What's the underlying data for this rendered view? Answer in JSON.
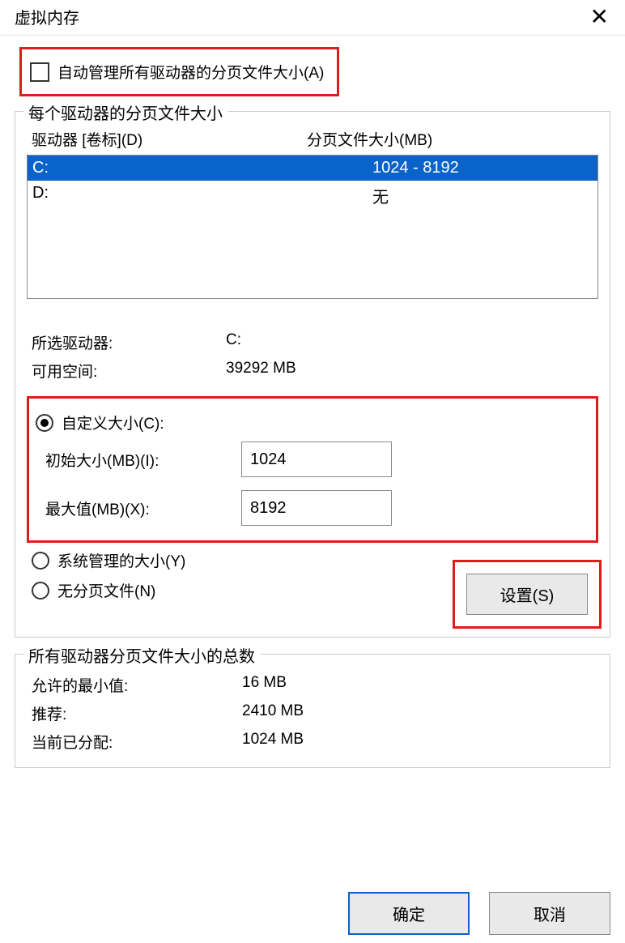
{
  "title": "虚拟内存",
  "auto_manage_label": "自动管理所有驱动器的分页文件大小(A)",
  "group1_legend": "每个驱动器的分页文件大小",
  "header_drive": "驱动器 [卷标](D)",
  "header_size": "分页文件大小(MB)",
  "drives": [
    {
      "name": "C:",
      "size": "1024 - 8192",
      "selected": true
    },
    {
      "name": "D:",
      "size": "无",
      "selected": false
    }
  ],
  "selected_drive_label": "所选驱动器:",
  "selected_drive_value": "C:",
  "free_space_label": "可用空间:",
  "free_space_value": "39292 MB",
  "custom_radio": "自定义大小(C):",
  "initial_label": "初始大小(MB)(I):",
  "initial_value": "1024",
  "max_label": "最大值(MB)(X):",
  "max_value": "8192",
  "system_radio": "系统管理的大小(Y)",
  "none_radio": "无分页文件(N)",
  "set_button": "设置(S)",
  "totals_legend": "所有驱动器分页文件大小的总数",
  "min_label": "允许的最小值:",
  "min_value": "16 MB",
  "rec_label": "推荐:",
  "rec_value": "2410 MB",
  "cur_label": "当前已分配:",
  "cur_value": "1024 MB",
  "ok_button": "确定",
  "cancel_button": "取消"
}
